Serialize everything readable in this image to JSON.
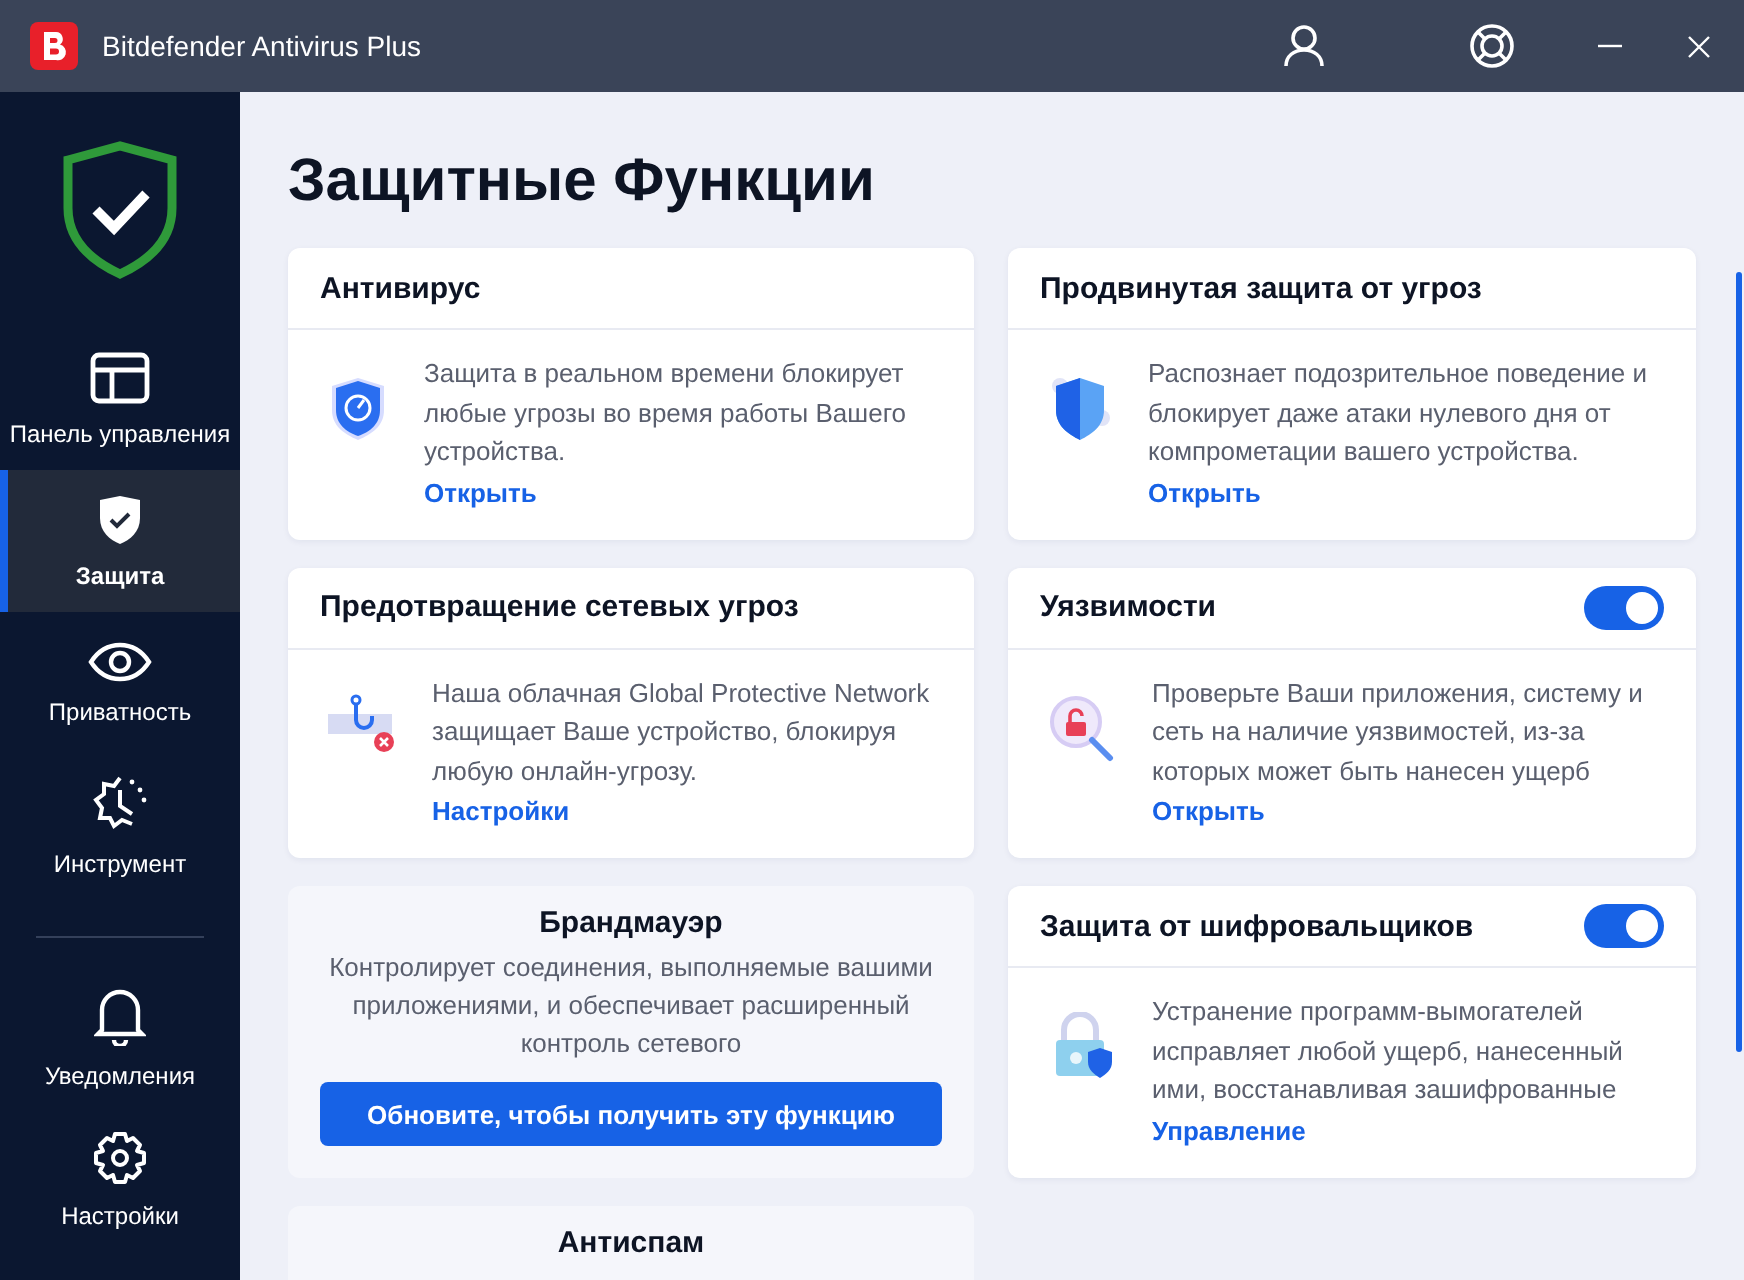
{
  "window": {
    "title": "Bitdefender Antivirus Plus"
  },
  "sidebar": {
    "items": [
      {
        "label": "Панель управления",
        "selected": false
      },
      {
        "label": "Защита",
        "selected": true
      },
      {
        "label": "Приватность",
        "selected": false
      },
      {
        "label": "Инструмент",
        "selected": false
      }
    ],
    "bottom_items": [
      {
        "label": "Уведомления",
        "selected": false
      },
      {
        "label": "Настройки",
        "selected": false
      }
    ]
  },
  "page_title": "Защитные Функции",
  "columns": [
    [
      {
        "kind": "feature",
        "title": "Антивирус",
        "description": "Защита в реальном времени блокирует любые угрозы во время работы Вашего устройства.",
        "link": "Открыть"
      },
      {
        "kind": "feature",
        "title": "Предотвращение сетевых угроз",
        "description": "Наша облачная Global Protective Network защищает Ваше устройство, блокируя любую онлайн-угрозу.",
        "link": "Настройки"
      },
      {
        "kind": "upgrade",
        "title": "Брандмауэр",
        "description": "Контролирует соединения, выполняемые вашими приложениями, и обеспечивает расширенный контроль сетевого",
        "button": "Обновите, чтобы получить эту функцию"
      },
      {
        "kind": "upgrade",
        "title": "Антиспам"
      }
    ],
    [
      {
        "kind": "feature",
        "title": "Продвинутая защита от угроз",
        "description": "Распознает подозрительное поведение и блокирует даже атаки нулевого дня от компрометации вашего устройства.",
        "link": "Открыть"
      },
      {
        "kind": "feature",
        "title": "Уязвимости",
        "on": true,
        "description": "Проверьте Ваши приложения, систему и сеть на наличие уязвимостей, из-за которых может быть нанесен ущерб",
        "link": "Открыть"
      },
      {
        "kind": "feature",
        "title": "Защита от шифровальщиков",
        "on": true,
        "description": "Устранение программ-вымогателей исправляет любой ущерб, нанесенный ими, восстанавливая зашифрованные",
        "link": "Управление"
      }
    ]
  ]
}
